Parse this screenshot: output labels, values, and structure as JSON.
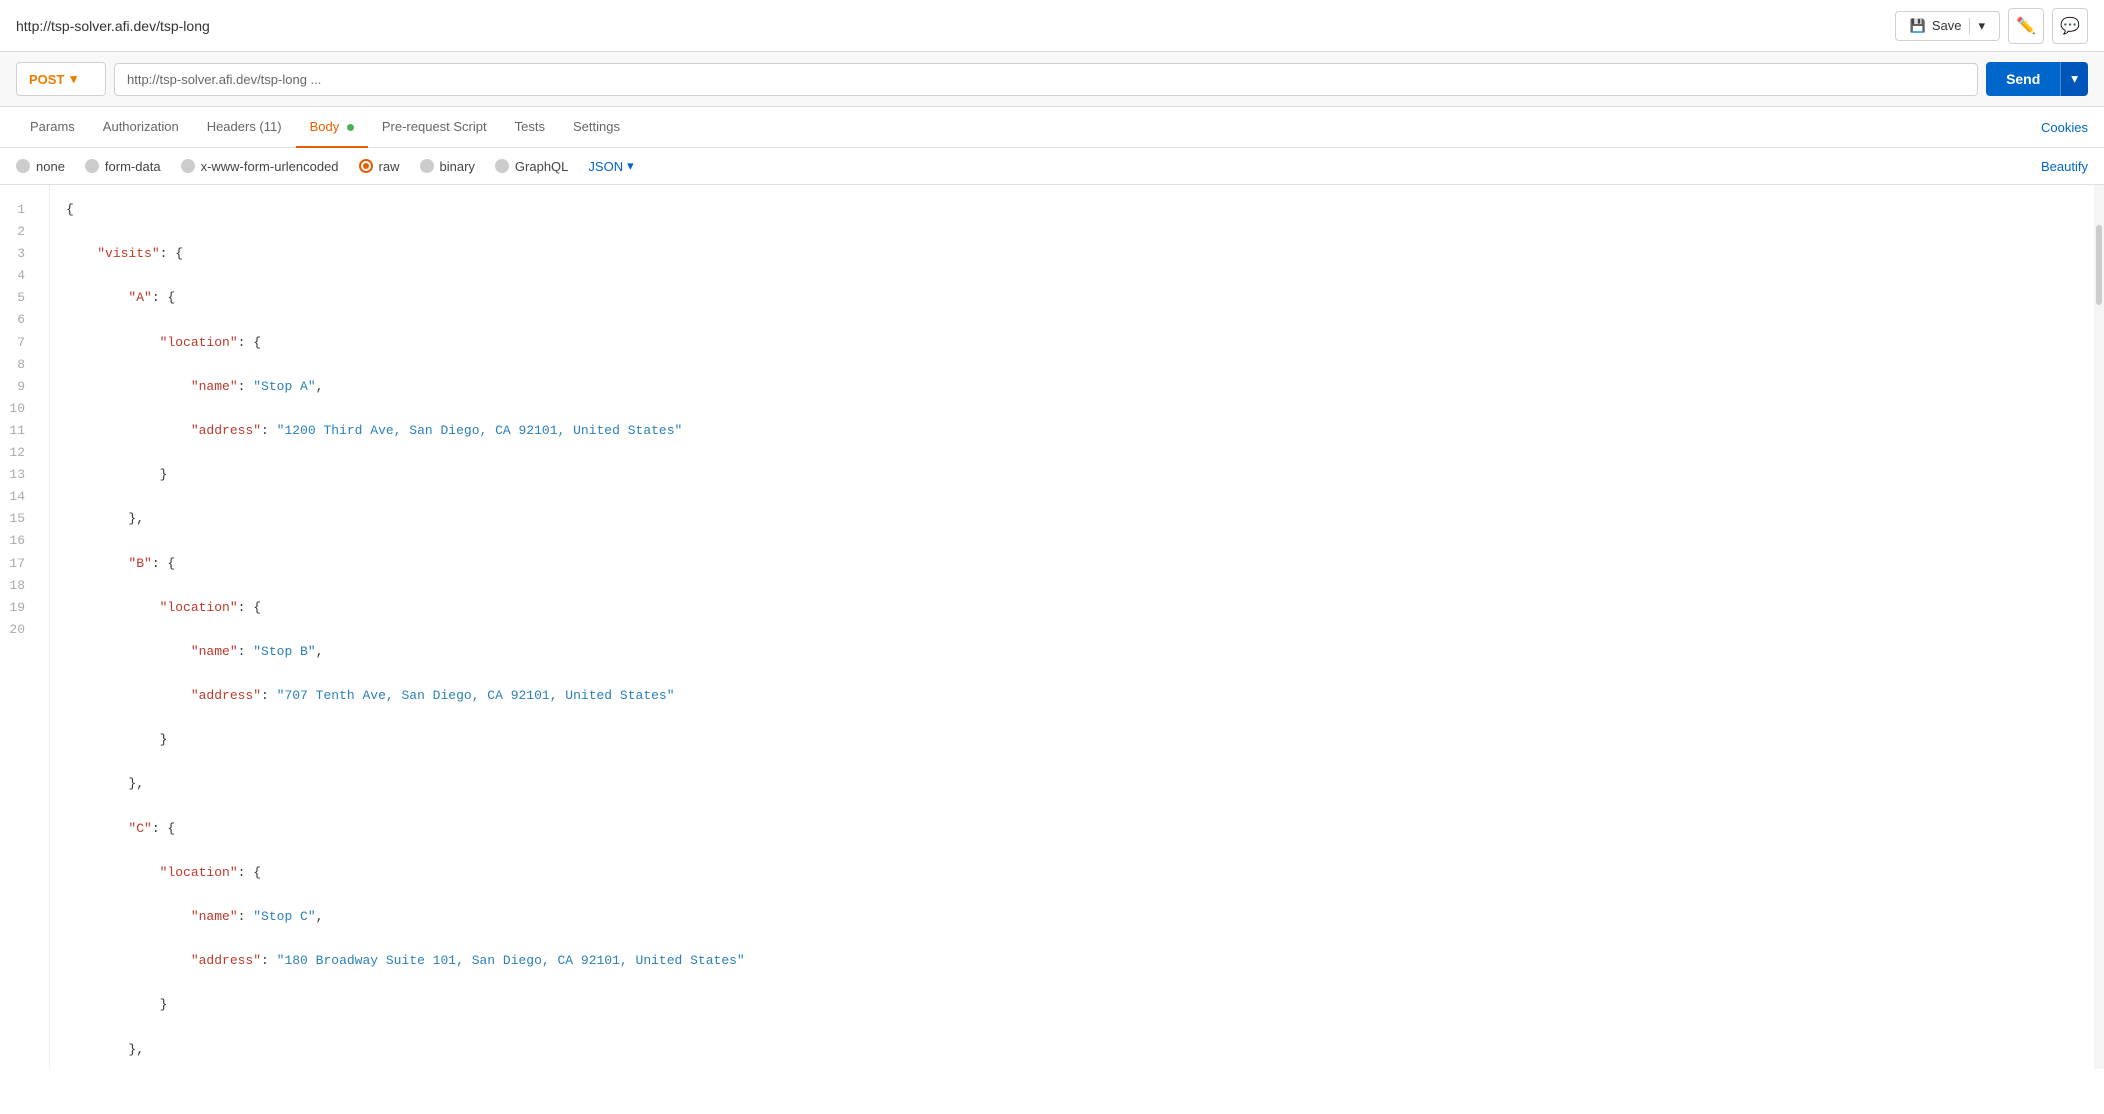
{
  "titleBar": {
    "url": "http://tsp-solver.afi.dev/tsp-long",
    "saveLabel": "Save",
    "editIcon": "✏",
    "commentIcon": "💬"
  },
  "requestBar": {
    "method": "POST",
    "url": "http://tsp-solver.afi.dev/tsp-long ...",
    "sendLabel": "Send"
  },
  "tabs": [
    {
      "id": "params",
      "label": "Params",
      "active": false
    },
    {
      "id": "authorization",
      "label": "Authorization",
      "active": false
    },
    {
      "id": "headers",
      "label": "Headers (11)",
      "active": false
    },
    {
      "id": "body",
      "label": "Body",
      "active": true,
      "hasDot": true
    },
    {
      "id": "prerequest",
      "label": "Pre-request Script",
      "active": false
    },
    {
      "id": "tests",
      "label": "Tests",
      "active": false
    },
    {
      "id": "settings",
      "label": "Settings",
      "active": false
    }
  ],
  "cookiesLabel": "Cookies",
  "bodyOptions": [
    {
      "id": "none",
      "label": "none",
      "selected": false
    },
    {
      "id": "form-data",
      "label": "form-data",
      "selected": false
    },
    {
      "id": "x-www-form-urlencoded",
      "label": "x-www-form-urlencoded",
      "selected": false
    },
    {
      "id": "raw",
      "label": "raw",
      "selected": true
    },
    {
      "id": "binary",
      "label": "binary",
      "selected": false
    },
    {
      "id": "graphql",
      "label": "GraphQL",
      "selected": false
    }
  ],
  "jsonDropdown": "JSON",
  "beautifyLabel": "Beautify",
  "codeLines": [
    {
      "num": 1,
      "content": "{"
    },
    {
      "num": 2,
      "content": "    \"visits\": {"
    },
    {
      "num": 3,
      "content": "        \"A\": {"
    },
    {
      "num": 4,
      "content": "            \"location\": {"
    },
    {
      "num": 5,
      "content": "                \"name\": \"Stop A\","
    },
    {
      "num": 6,
      "content": "                \"address\": \"1200 Third Ave, San Diego, CA 92101, United States\""
    },
    {
      "num": 7,
      "content": "            }"
    },
    {
      "num": 8,
      "content": "        },"
    },
    {
      "num": 9,
      "content": "        \"B\": {"
    },
    {
      "num": 10,
      "content": "            \"location\": {"
    },
    {
      "num": 11,
      "content": "                \"name\": \"Stop B\","
    },
    {
      "num": 12,
      "content": "                \"address\": \"707 Tenth Ave, San Diego, CA 92101, United States\""
    },
    {
      "num": 13,
      "content": "            }"
    },
    {
      "num": 14,
      "content": "        },"
    },
    {
      "num": 15,
      "content": "        \"C\": {"
    },
    {
      "num": 16,
      "content": "            \"location\": {"
    },
    {
      "num": 17,
      "content": "                \"name\": \"Stop C\","
    },
    {
      "num": 18,
      "content": "                \"address\": \"180 Broadway Suite 101, San Diego, CA 92101, United States\""
    },
    {
      "num": 19,
      "content": "            }"
    },
    {
      "num": 20,
      "content": "        },"
    }
  ]
}
